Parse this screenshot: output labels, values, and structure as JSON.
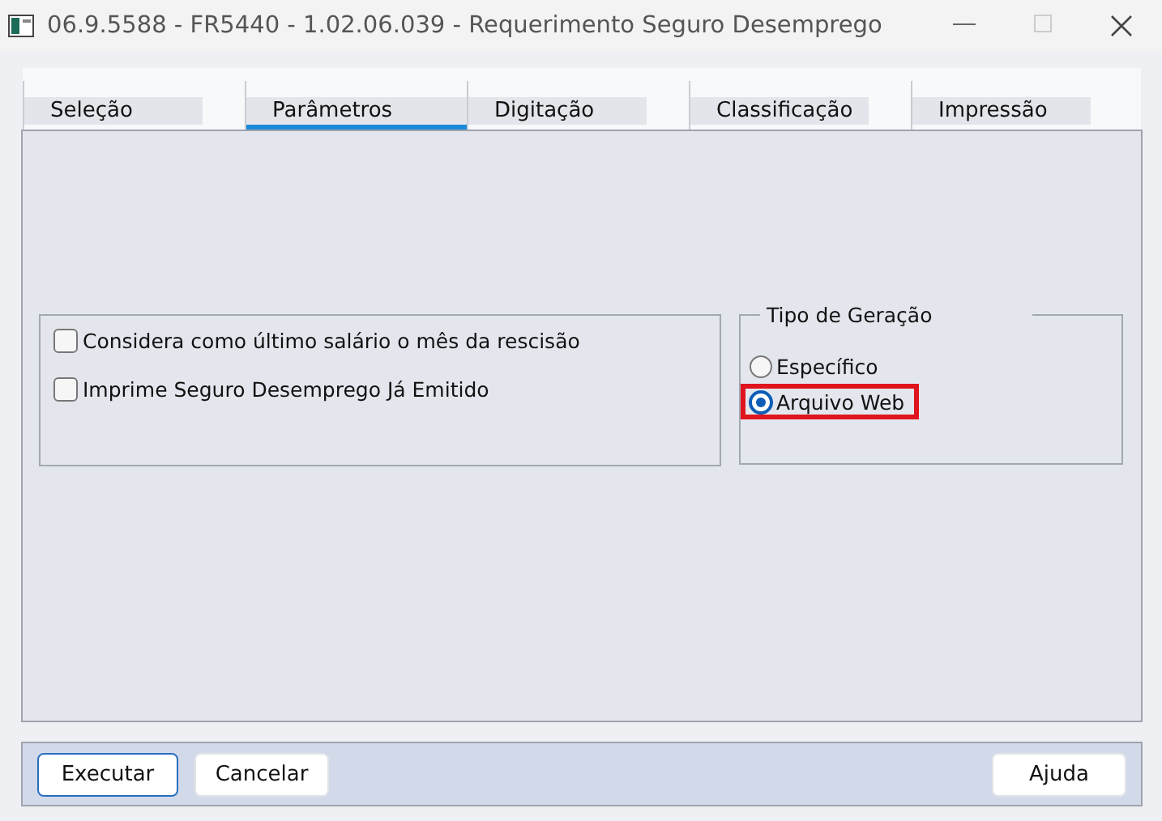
{
  "window": {
    "title": "06.9.5588 - FR5440 - 1.02.06.039 - Requerimento Seguro Desemprego"
  },
  "tabs": [
    {
      "label": "Seleção",
      "selected": false
    },
    {
      "label": "Parâmetros",
      "selected": true
    },
    {
      "label": "Digitação",
      "selected": false
    },
    {
      "label": "Classificação",
      "selected": false
    },
    {
      "label": "Impressão",
      "selected": false
    }
  ],
  "options": [
    {
      "label": "Considera como último salário o mês da rescisão",
      "checked": false
    },
    {
      "label": "Imprime Seguro Desemprego Já Emitido",
      "checked": false
    }
  ],
  "generation_type": {
    "title": "Tipo de Geração",
    "choices": [
      {
        "label": "Específico",
        "selected": false,
        "highlighted": false
      },
      {
        "label": "Arquivo Web",
        "selected": true,
        "highlighted": true
      }
    ]
  },
  "buttons": [
    {
      "label": "Executar",
      "focused": true
    },
    {
      "label": "Cancelar",
      "focused": false
    },
    {
      "label": "Ajuda",
      "focused": false
    }
  ]
}
